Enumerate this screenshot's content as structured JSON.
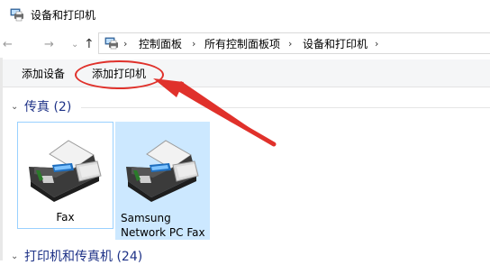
{
  "window": {
    "title": "设备和打印机",
    "icon": "devices-printers-icon"
  },
  "nav": {
    "back_icon": "back-arrow-icon",
    "forward_icon": "forward-arrow-icon",
    "recent_icon": "chevron-down-icon",
    "up_icon": "up-arrow-icon",
    "back_glyph": "←",
    "forward_glyph": "→",
    "recent_glyph": "⌄",
    "up_glyph": "↑"
  },
  "breadcrumb": {
    "separator": "›",
    "items": [
      "控制面板",
      "所有控制面板项",
      "设备和打印机"
    ]
  },
  "commands": {
    "add_device": "添加设备",
    "add_printer": "添加打印机"
  },
  "groups": [
    {
      "header": "传真 (2)",
      "expanded": true,
      "chevron": "⌄",
      "items": [
        {
          "label": "Fax",
          "icon": "fax-machine-icon",
          "selected": false,
          "focused": true
        },
        {
          "label": "Samsung Network PC Fax",
          "label_lines": [
            "Samsung",
            "Network PC Fax"
          ],
          "icon": "fax-machine-icon",
          "selected": true
        }
      ]
    },
    {
      "header": "打印机和传真机 (24)",
      "expanded": true,
      "chevron": "⌄"
    }
  ],
  "colors": {
    "group_header": "#1e3287",
    "selection_fill": "#cce8ff",
    "focus_border": "#99d1ff",
    "annotation_red": "#e0312b"
  }
}
